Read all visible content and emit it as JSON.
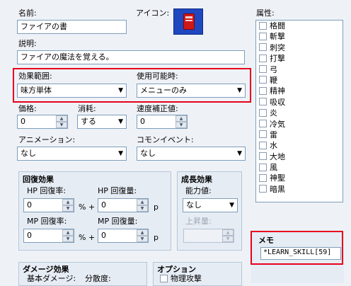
{
  "colors": {
    "accent_red": "#e8001c",
    "icon_blue": "#1f47c0",
    "icon_red": "#d01818"
  },
  "name": {
    "label": "名前:",
    "value": "ファイアの書"
  },
  "icon": {
    "label": "アイコン:",
    "icon_name": "red-book-icon"
  },
  "description": {
    "label": "説明:",
    "value": "ファイアの魔法を覚える。"
  },
  "scope": {
    "label": "効果範囲:",
    "value": "味方単体"
  },
  "occasion": {
    "label": "使用可能時:",
    "value": "メニューのみ"
  },
  "price": {
    "label": "価格:",
    "value": "0"
  },
  "consumable": {
    "label": "消耗:",
    "value": "する"
  },
  "speed": {
    "label": "速度補正値:",
    "value": "0"
  },
  "animation": {
    "label": "アニメーション:",
    "value": "なし"
  },
  "common_event": {
    "label": "コモンイベント:",
    "value": "なし"
  },
  "recovery": {
    "title": "回復効果",
    "hp_rate_label": "HP 回復率:",
    "hp_rate_value": "0",
    "hp_amount_label": "HP 回復量:",
    "hp_amount_value": "0",
    "mp_rate_label": "MP 回復率:",
    "mp_rate_value": "0",
    "mp_amount_label": "MP 回復量:",
    "mp_amount_value": "0",
    "pct_plus": "% +",
    "p": "p"
  },
  "growth": {
    "title": "成長効果",
    "param_label": "能力値:",
    "param_value": "なし",
    "increase_label": "上昇量:"
  },
  "damage": {
    "title": "ダメージ効果",
    "base_label": "基本ダメージ:",
    "variance_label": "分散度:"
  },
  "options": {
    "title": "オプション",
    "physical_label": "物理攻撃"
  },
  "attributes": {
    "label": "属性:",
    "items": [
      "格闘",
      "斬撃",
      "刺突",
      "打撃",
      "弓",
      "鞭",
      "精神",
      "吸収",
      "炎",
      "冷気",
      "雷",
      "水",
      "大地",
      "風",
      "神聖",
      "暗黒"
    ]
  },
  "memo": {
    "title": "メモ",
    "value": "*LEARN_SKILL[59]"
  }
}
